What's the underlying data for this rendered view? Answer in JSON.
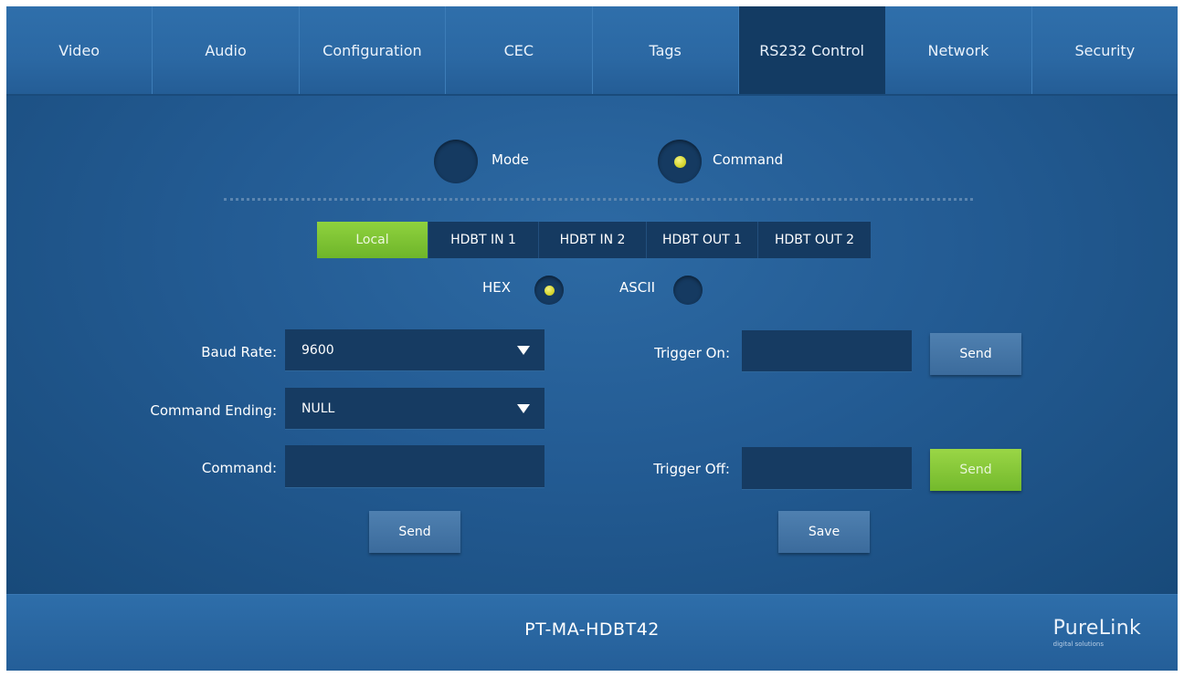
{
  "nav": {
    "tabs": [
      {
        "label": "Video"
      },
      {
        "label": "Audio"
      },
      {
        "label": "Configuration"
      },
      {
        "label": "CEC"
      },
      {
        "label": "Tags"
      },
      {
        "label": "RS232 Control",
        "active": true
      },
      {
        "label": "Network"
      },
      {
        "label": "Security"
      }
    ]
  },
  "mode": {
    "mode_label": "Mode",
    "command_label": "Command",
    "selected": "Command"
  },
  "ports": {
    "items": [
      {
        "label": "Local",
        "active": true
      },
      {
        "label": "HDBT IN 1"
      },
      {
        "label": "HDBT IN 2"
      },
      {
        "label": "HDBT OUT 1"
      },
      {
        "label": "HDBT OUT 2"
      }
    ]
  },
  "format": {
    "hex_label": "HEX",
    "ascii_label": "ASCII",
    "selected": "HEX"
  },
  "form": {
    "baud_rate_label": "Baud Rate:",
    "baud_rate_value": "9600",
    "command_ending_label": "Command Ending:",
    "command_ending_value": "NULL",
    "command_label": "Command:",
    "command_value": "",
    "send_label": "Send",
    "trigger_on_label": "Trigger On:",
    "trigger_on_value": "",
    "trigger_on_send_label": "Send",
    "trigger_off_label": "Trigger Off:",
    "trigger_off_value": "",
    "trigger_off_send_label": "Send",
    "save_label": "Save"
  },
  "footer": {
    "model": "PT-MA-HDBT42",
    "brand": "PureLink",
    "brand_tagline": "digital solutions"
  },
  "colors": {
    "accent_green": "#7dc233",
    "radio_dot_yellow": "#d9d833",
    "panel_dark": "#153a61",
    "nav_blue": "#2b68a3"
  }
}
